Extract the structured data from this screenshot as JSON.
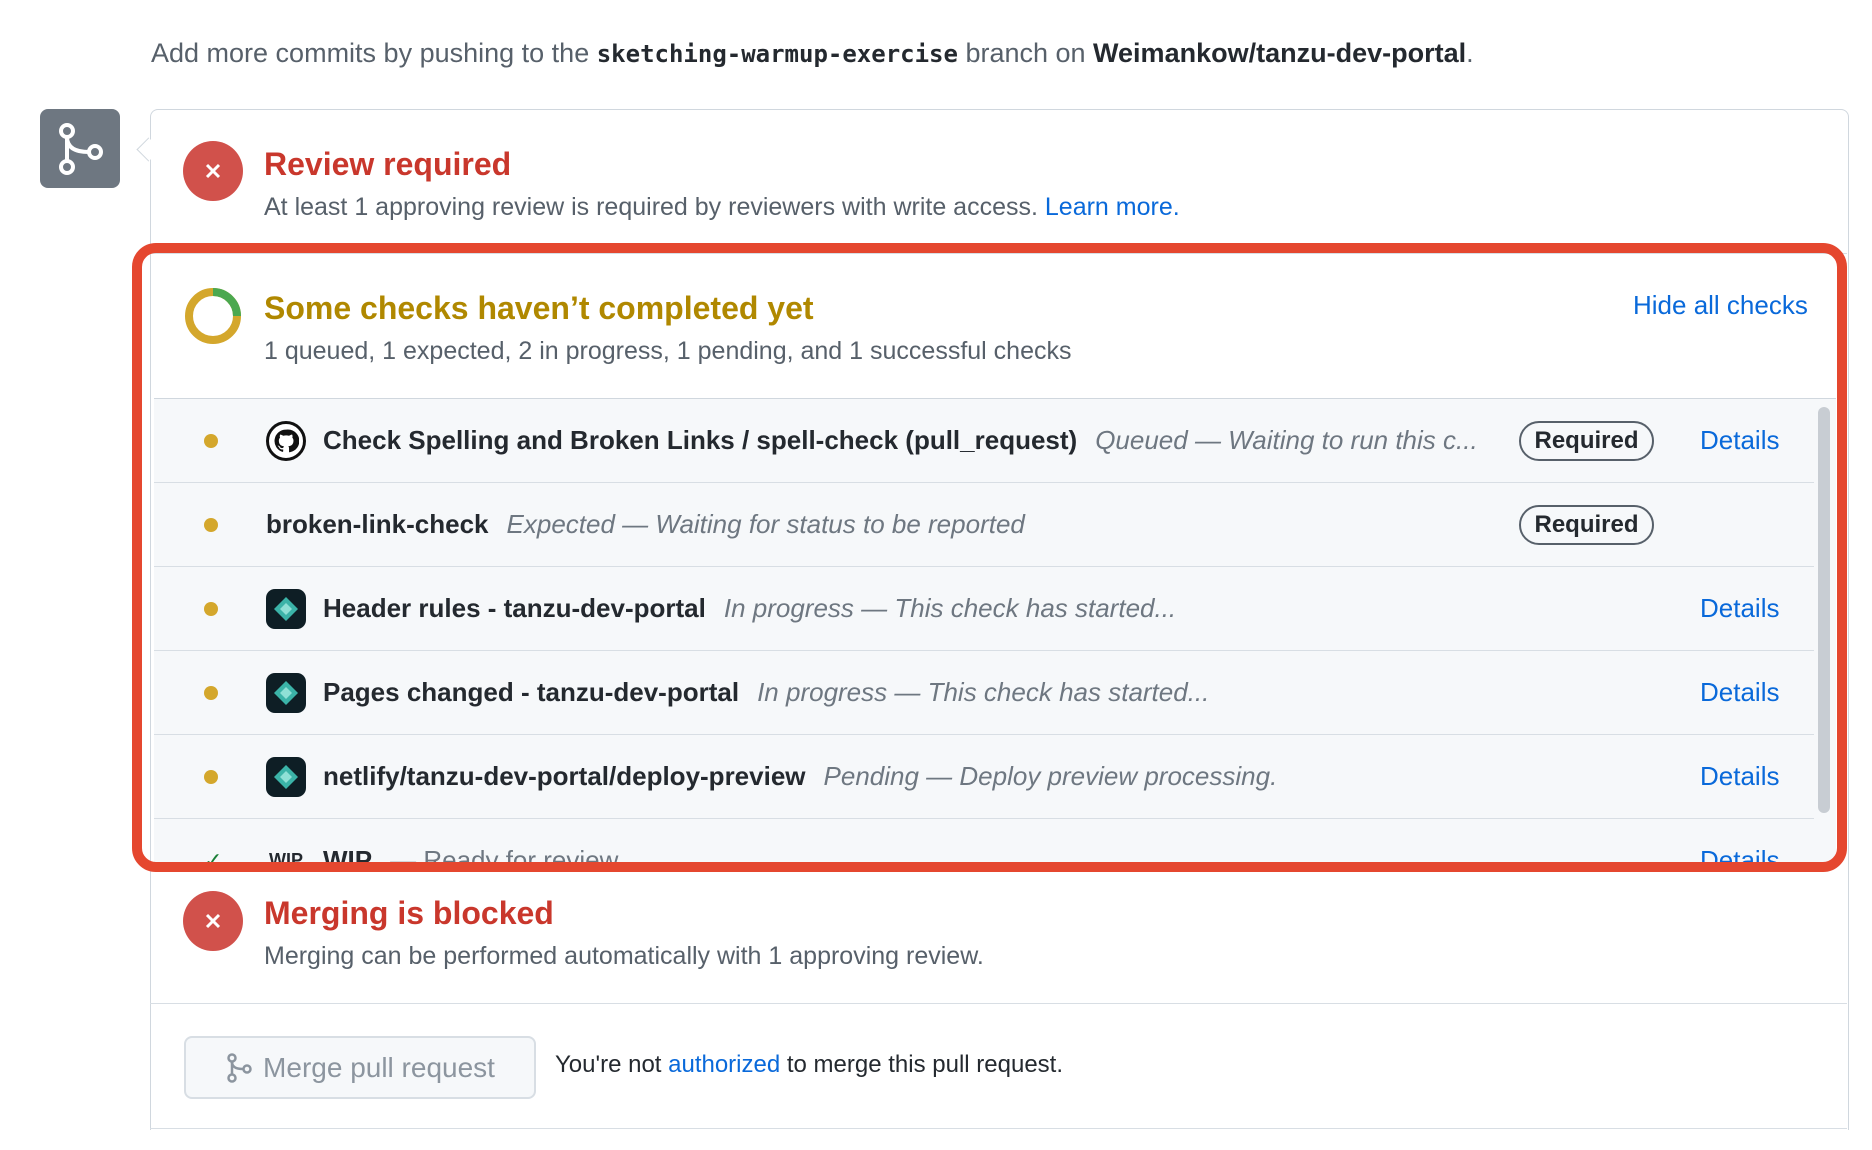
{
  "intro": {
    "prefix": "Add more commits by pushing to the ",
    "branch": "sketching-warmup-exercise",
    "middle": " branch on ",
    "repo": "Weimankow/tanzu-dev-portal",
    "suffix": "."
  },
  "review": {
    "title": "Review required",
    "description": "At least 1 approving review is required by reviewers with write access.",
    "learn_more": "Learn more."
  },
  "checks": {
    "title": "Some checks haven’t completed yet",
    "summary": "1 queued, 1 expected, 2 in progress, 1 pending, and 1 successful checks",
    "toggle_label": "Hide all checks",
    "items": [
      {
        "name": "Check Spelling and Broken Links / spell-check (pull_request)",
        "desc": "Queued — Waiting to run this c...",
        "badge": "Required",
        "details": "Details",
        "avatar": "github-icon"
      },
      {
        "name": "broken-link-check",
        "desc": "Expected — Waiting for status to be reported",
        "badge": "Required",
        "details": "",
        "avatar": ""
      },
      {
        "name": "Header rules - tanzu-dev-portal",
        "desc": "In progress — This check has started...",
        "badge": "",
        "details": "Details",
        "avatar": "netlify-icon"
      },
      {
        "name": "Pages changed - tanzu-dev-portal",
        "desc": "In progress — This check has started...",
        "badge": "",
        "details": "Details",
        "avatar": "netlify-icon"
      },
      {
        "name": "netlify/tanzu-dev-portal/deploy-preview",
        "desc": "Pending — Deploy preview processing.",
        "badge": "",
        "details": "Details",
        "avatar": "netlify-icon"
      },
      {
        "name": "WIP",
        "desc": "— Ready for review",
        "badge": "",
        "details": "Details",
        "avatar": "wip-icon",
        "avatar_text": "WIP"
      }
    ]
  },
  "merge_status": {
    "title": "Merging is blocked",
    "description": "Merging can be performed automatically with 1 approving review."
  },
  "merge_action": {
    "button_label": "Merge pull request",
    "note_prefix": "You're not ",
    "note_link": "authorized",
    "note_suffix": " to merge this pull request."
  },
  "colors": {
    "error": "#d1514b",
    "pending": "#d4a72c",
    "link": "#0969da",
    "highlight": "#e5472f"
  }
}
